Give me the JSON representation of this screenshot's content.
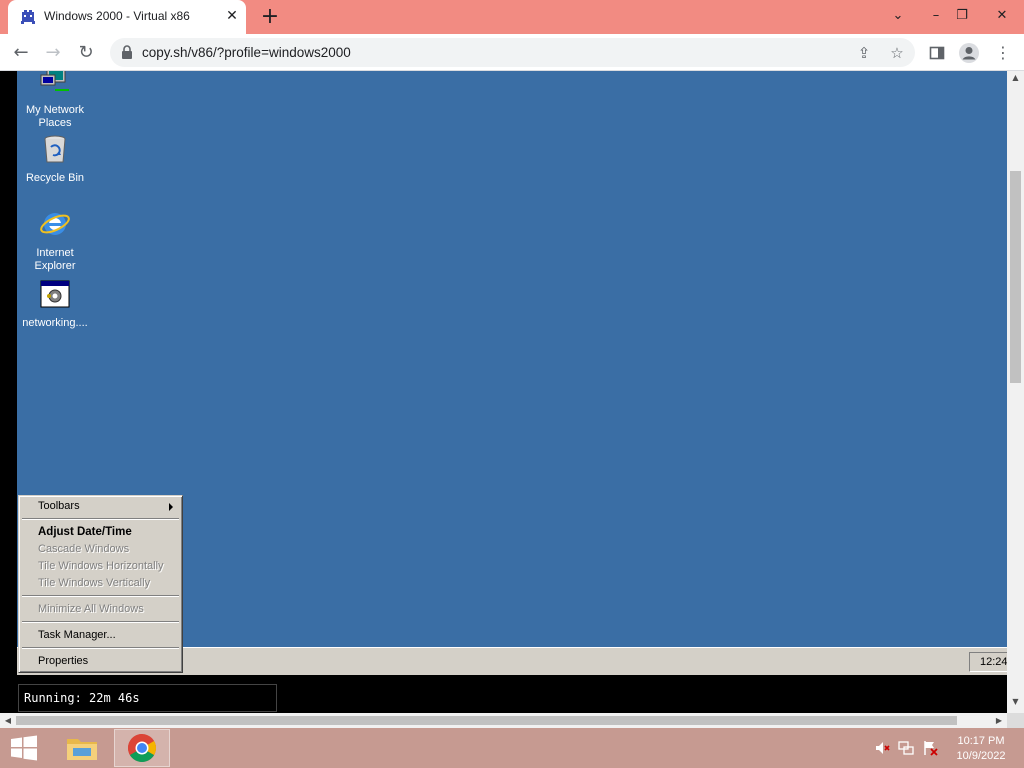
{
  "browser": {
    "tab_title": "Windows 2000 - Virtual x86",
    "url": "copy.sh/v86/?profile=windows2000"
  },
  "desktop": {
    "icons": [
      {
        "label": "My Network Places",
        "icon": "network-places-icon"
      },
      {
        "label": "Recycle Bin",
        "icon": "recycle-bin-icon"
      },
      {
        "label": "Internet Explorer",
        "icon": "internet-explorer-icon"
      },
      {
        "label": "networking....",
        "icon": "setup-program-icon"
      }
    ],
    "background_color": "#3a6ea5"
  },
  "context_menu": {
    "items": [
      {
        "label": "Toolbars",
        "enabled": true,
        "submenu": true
      },
      {
        "label": "Adjust Date/Time",
        "enabled": true,
        "default": true
      },
      {
        "label": "Cascade Windows",
        "enabled": false
      },
      {
        "label": "Tile Windows Horizontally",
        "enabled": false
      },
      {
        "label": "Tile Windows Vertically",
        "enabled": false
      },
      {
        "label": "Minimize All Windows",
        "enabled": false
      },
      {
        "label": "Task Manager...",
        "enabled": true
      },
      {
        "label": "Properties",
        "enabled": true
      }
    ]
  },
  "guest_taskbar": {
    "clock": "12:24"
  },
  "emulator": {
    "status": "Running: 22m 46s"
  },
  "host_taskbar": {
    "time": "10:17 PM",
    "date": "10/9/2022",
    "pinned": [
      "start-icon",
      "file-explorer-icon",
      "chrome-icon"
    ],
    "tray": [
      "volume-muted-icon",
      "network-icon",
      "action-center-icon"
    ]
  },
  "colors": {
    "tabbar": "#f28b82",
    "host_taskbar": "#c69a91"
  }
}
